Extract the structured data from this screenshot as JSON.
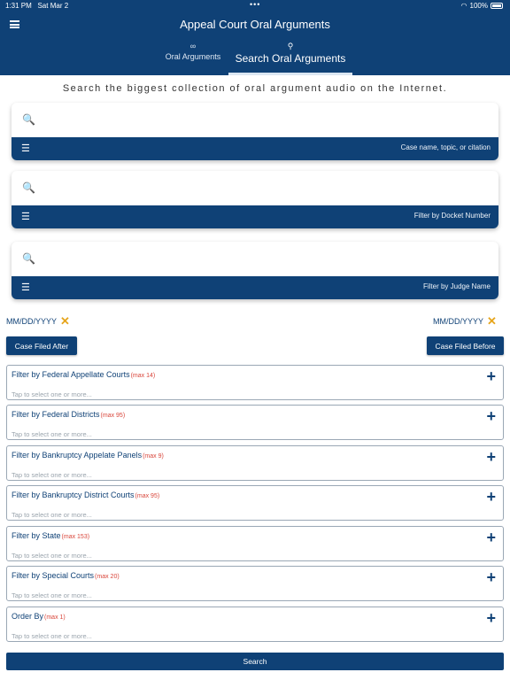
{
  "status_bar": {
    "time": "1:31 PM",
    "date": "Sat Mar 2",
    "dots": "•••",
    "battery": "100%"
  },
  "header": {
    "title": "Appeal Court Oral Arguments",
    "icons": {
      "menu": "hamburger-icon"
    }
  },
  "tabs": [
    {
      "label": "Oral Arguments",
      "icon": "voicemail-icon",
      "glyph": "∞",
      "active": false
    },
    {
      "label": "Search Oral Arguments",
      "icon": "search-icon",
      "glyph": "⚲",
      "active": true
    }
  ],
  "tagline": "Search the biggest collection of oral argument audio on the Internet.",
  "search_fields": [
    {
      "value": "",
      "hint": "Case name, topic, or citation"
    },
    {
      "value": "",
      "hint": "Filter by Docket Number"
    },
    {
      "value": "",
      "hint": "Filter by Judge Name"
    }
  ],
  "glyphs": {
    "search": "🔍",
    "list": "☰",
    "clear": "✕",
    "plus": "+"
  },
  "dates": {
    "after": {
      "placeholder": "MM/DD/YYYY",
      "button": "Case Filed After"
    },
    "before": {
      "placeholder": "MM/DD/YYYY",
      "button": "Case Filed Before"
    }
  },
  "filters": [
    {
      "title": "Filter by Federal Appellate Courts",
      "max": "(max 14)",
      "placeholder": "Tap to select one or more..."
    },
    {
      "title": "Filter by Federal Districts",
      "max": "(max 95)",
      "placeholder": "Tap to select one or more..."
    },
    {
      "title": "Filter by Bankruptcy Appelate Panels",
      "max": "(max 9)",
      "placeholder": "Tap to select one or more..."
    },
    {
      "title": "Filter by Bankruptcy District Courts",
      "max": "(max 95)",
      "placeholder": "Tap to select one or more..."
    },
    {
      "title": "Filter by State",
      "max": "(max 153)",
      "placeholder": "Tap to select one or more..."
    },
    {
      "title": "Filter by Special Courts",
      "max": "(max 20)",
      "placeholder": "Tap to select one or more..."
    },
    {
      "title": "Order By",
      "max": "(max 1)",
      "placeholder": "Tap to select one or more..."
    }
  ],
  "search_button": "Search",
  "colors": {
    "primary": "#0f4176",
    "accent": "#e6a51c",
    "max_label": "#d9453a"
  }
}
